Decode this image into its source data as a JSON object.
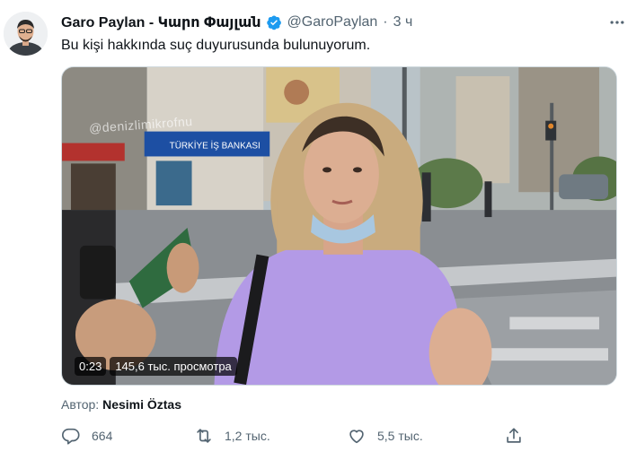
{
  "tweet": {
    "display_name": "Garo Paylan - Կարո Փայլան",
    "handle": "@GaroPaylan",
    "separator": "·",
    "time": "3 ч",
    "text": "Bu kişi hakkında suç duyurusunda bulunuyorum.",
    "verified_color": "#1d9bf0"
  },
  "media": {
    "watermark": "@denizlimikrofnu",
    "bank_sign": "TÜRKİYE İŞ BANKASI",
    "duration": "0:23",
    "views": "145,6 тыс. просмотра"
  },
  "author": {
    "label": "Автор:",
    "name": "Nesimi Öztas"
  },
  "actions": {
    "replies": "664",
    "retweets": "1,2 тыс.",
    "likes": "5,5 тыс."
  },
  "icons": {
    "more": "more-horizontal-icon",
    "reply": "reply-icon",
    "retweet": "retweet-icon",
    "like": "heart-icon",
    "share": "share-icon"
  }
}
